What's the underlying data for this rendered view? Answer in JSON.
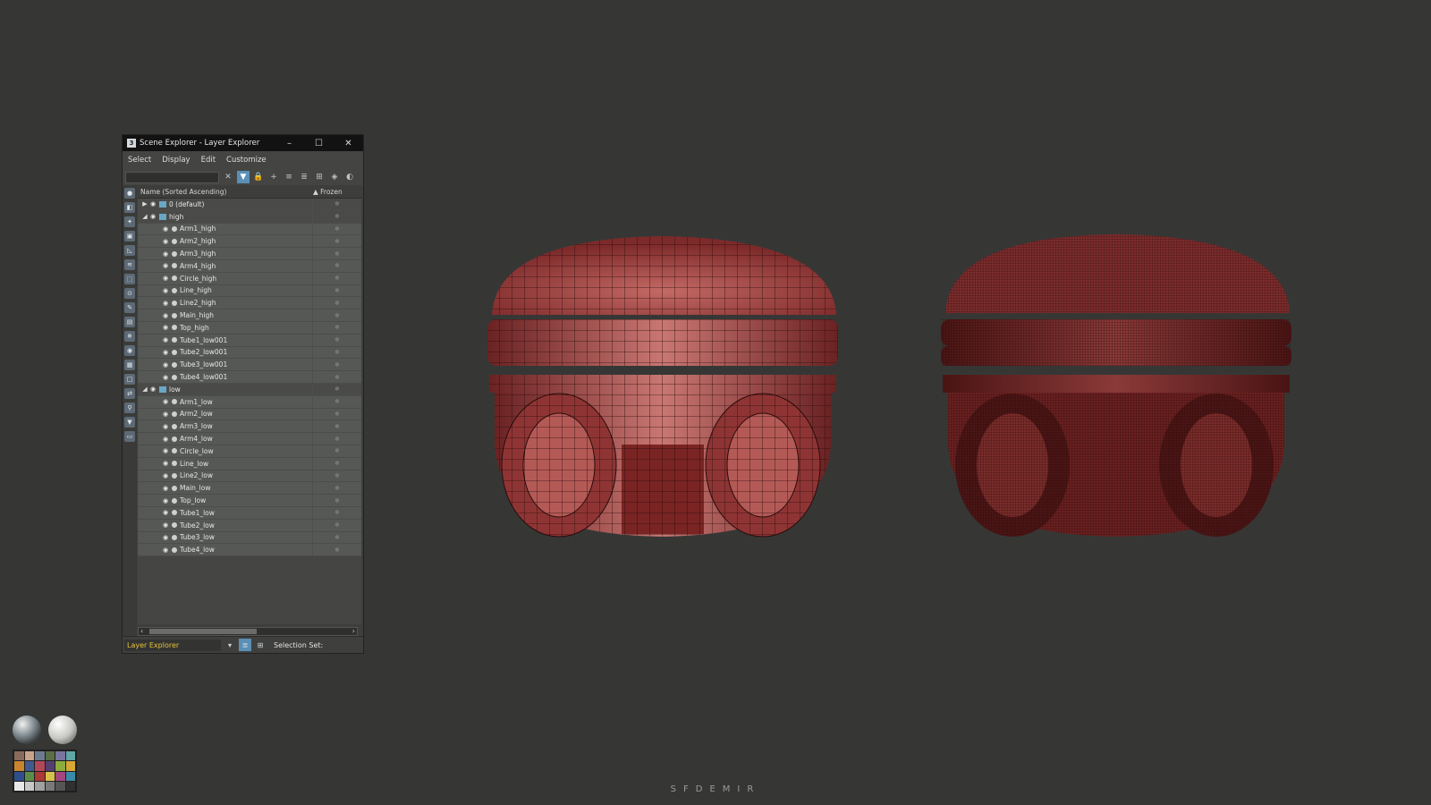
{
  "window": {
    "title": "Scene Explorer - Layer Explorer",
    "minimize": "–",
    "maximize": "☐",
    "close": "✕"
  },
  "menu": [
    "Select",
    "Display",
    "Edit",
    "Customize"
  ],
  "search": {
    "value": "",
    "clear": "✕"
  },
  "columns": {
    "name": "Name (Sorted Ascending)",
    "frozen": "▲ Frozen"
  },
  "rows": [
    {
      "label": "0 (default)",
      "type": "layer",
      "expander": "▶"
    },
    {
      "label": "high",
      "type": "layer",
      "expander": "◢"
    },
    {
      "label": "Arm1_high",
      "type": "object"
    },
    {
      "label": "Arm2_high",
      "type": "object"
    },
    {
      "label": "Arm3_high",
      "type": "object"
    },
    {
      "label": "Arm4_high",
      "type": "object"
    },
    {
      "label": "Circle_high",
      "type": "object"
    },
    {
      "label": "Line_high",
      "type": "object"
    },
    {
      "label": "Line2_high",
      "type": "object"
    },
    {
      "label": "Main_high",
      "type": "object"
    },
    {
      "label": "Top_high",
      "type": "object"
    },
    {
      "label": "Tube1_low001",
      "type": "object"
    },
    {
      "label": "Tube2_low001",
      "type": "object"
    },
    {
      "label": "Tube3_low001",
      "type": "object"
    },
    {
      "label": "Tube4_low001",
      "type": "object"
    },
    {
      "label": "low",
      "type": "layer",
      "expander": "◢"
    },
    {
      "label": "Arm1_low",
      "type": "object"
    },
    {
      "label": "Arm2_low",
      "type": "object"
    },
    {
      "label": "Arm3_low",
      "type": "object"
    },
    {
      "label": "Arm4_low",
      "type": "object"
    },
    {
      "label": "Circle_low",
      "type": "object"
    },
    {
      "label": "Line_low",
      "type": "object"
    },
    {
      "label": "Line2_low",
      "type": "object"
    },
    {
      "label": "Main_low",
      "type": "object"
    },
    {
      "label": "Top_low",
      "type": "object"
    },
    {
      "label": "Tube1_low",
      "type": "object"
    },
    {
      "label": "Tube2_low",
      "type": "object"
    },
    {
      "label": "Tube3_low",
      "type": "object"
    },
    {
      "label": "Tube4_low",
      "type": "object"
    }
  ],
  "status": {
    "explorer": "Layer Explorer",
    "selection_set": "Selection Set:"
  },
  "signature": "SFDEMIR",
  "colors": {
    "model_base": "#8e3030",
    "model_dark": "#5a1d1d",
    "accent": "#5a8fb6",
    "explorer_label": "#e8c23a"
  },
  "palette": [
    "#8a6a5a",
    "#c9a48a",
    "#6c7b8e",
    "#5b6e45",
    "#7a74a0",
    "#5fa6a6",
    "#c98430",
    "#3f5a8f",
    "#b0485a",
    "#54406e",
    "#8cad3c",
    "#d8a834",
    "#2f4e8c",
    "#5b8d48",
    "#a93a36",
    "#d6c24a",
    "#a4467e",
    "#3a8aa8",
    "#e8e8e8",
    "#c8c8c8",
    "#a0a0a0",
    "#7a7a7a",
    "#555555",
    "#303030"
  ]
}
